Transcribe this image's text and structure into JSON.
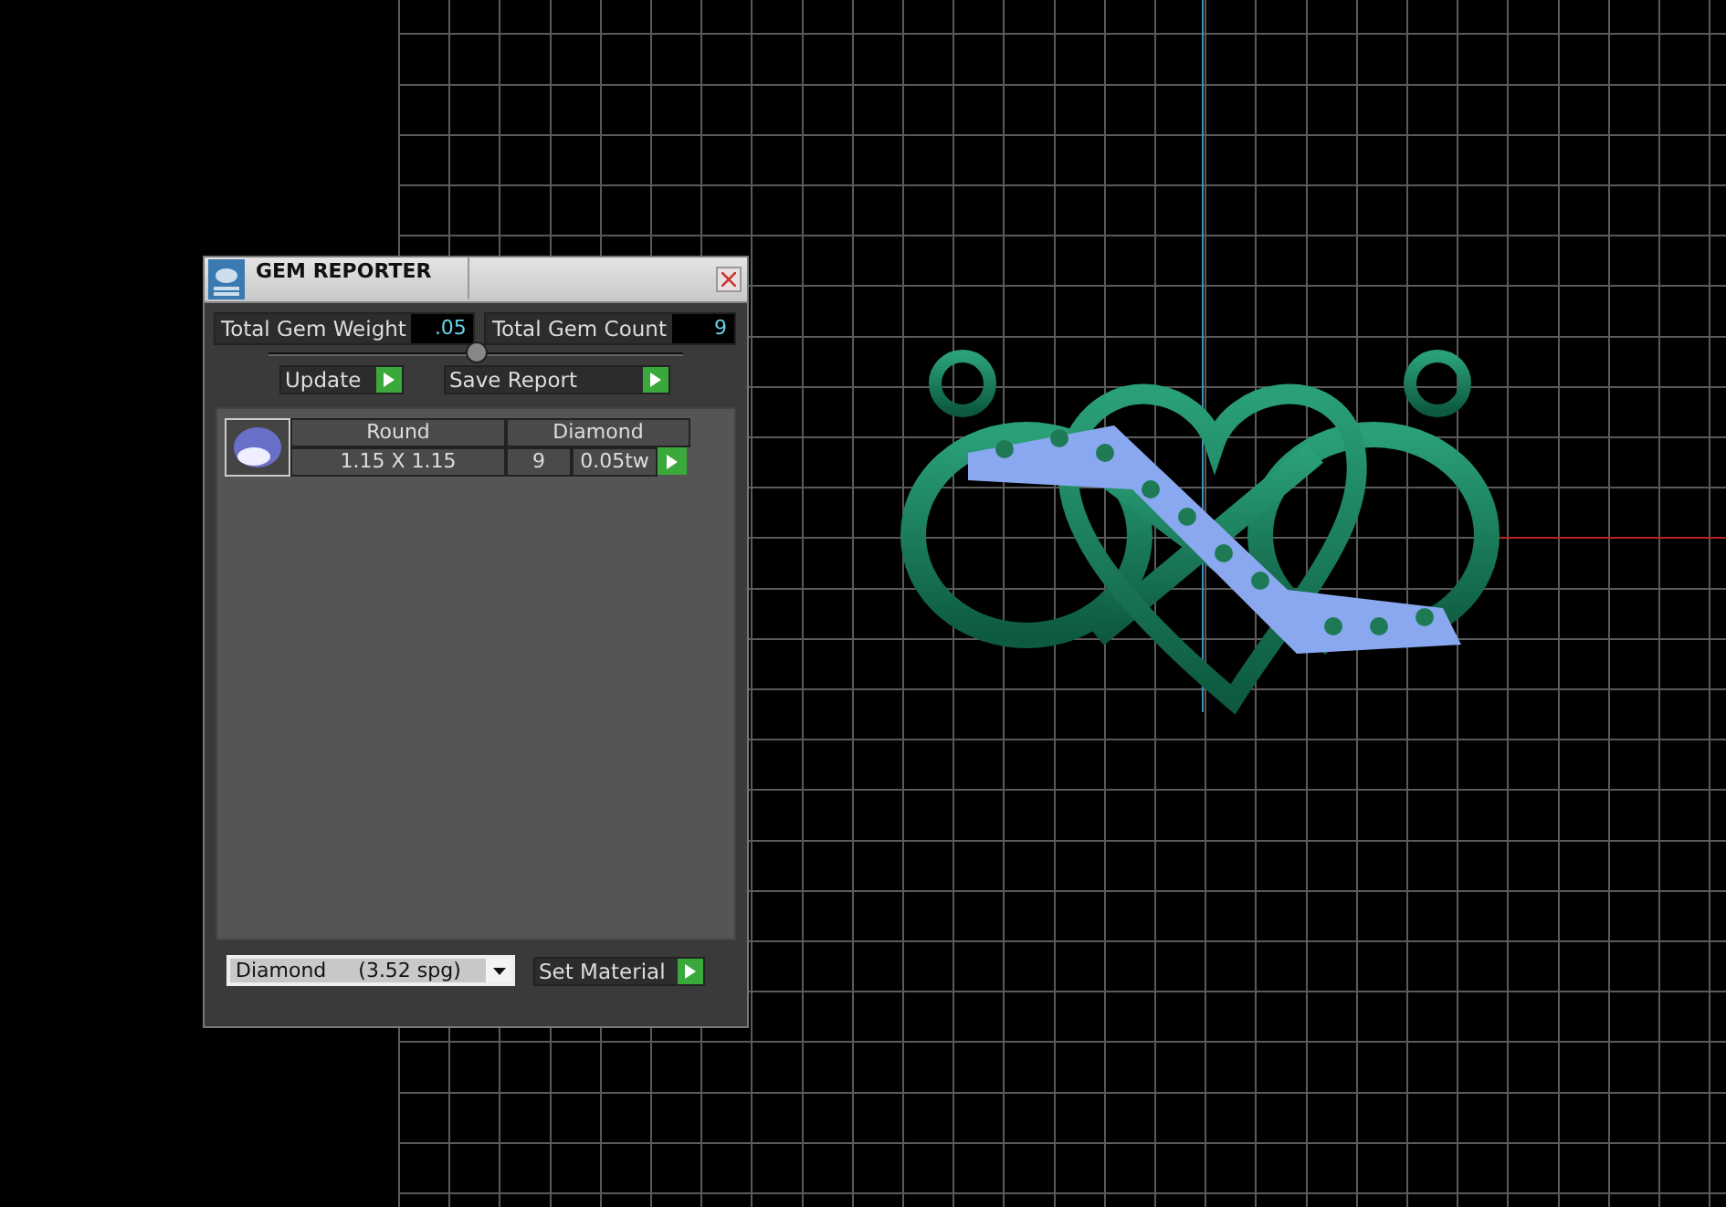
{
  "window": {
    "title": "GEM REPORTER"
  },
  "totals": [
    {
      "label": "Total Gem Weight",
      "value": ".05"
    },
    {
      "label": "Total Gem Count",
      "value": "9"
    }
  ],
  "actions": [
    {
      "label": "Update"
    },
    {
      "label": "Save Report"
    }
  ],
  "gems": [
    {
      "shape": "Round",
      "size": "1.15 X 1.15",
      "material": "Diamond",
      "count": "9",
      "weight": "0.05tw"
    }
  ],
  "material": {
    "value": "Diamond     (3.52 spg)",
    "button": "Set Material"
  }
}
